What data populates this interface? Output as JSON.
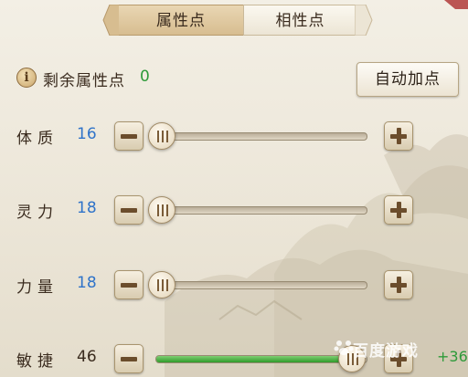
{
  "tabs": [
    {
      "label": "属性点",
      "active": true
    },
    {
      "label": "相性点",
      "active": false
    }
  ],
  "remaining": {
    "icon": "info-icon",
    "icon_glyph": "i",
    "label": "剩余属性点",
    "value": "0"
  },
  "auto_button": {
    "label": "自动加点"
  },
  "attributes": [
    {
      "label": "体质",
      "value": "16",
      "level": 0.0,
      "bonus": ""
    },
    {
      "label": "灵力",
      "value": "18",
      "level": 0.0,
      "bonus": ""
    },
    {
      "label": "力量",
      "value": "18",
      "level": 0.0,
      "bonus": ""
    },
    {
      "label": "敏捷",
      "value": "46",
      "level": 0.93,
      "bonus": "+36"
    }
  ],
  "watermark": {
    "text": "百度游戏"
  },
  "colors": {
    "value_blue": "#2f73c9",
    "value_green": "#2e9a3a",
    "tab_active": "#d7bd90",
    "slider_fill": "#2f9a2a"
  }
}
